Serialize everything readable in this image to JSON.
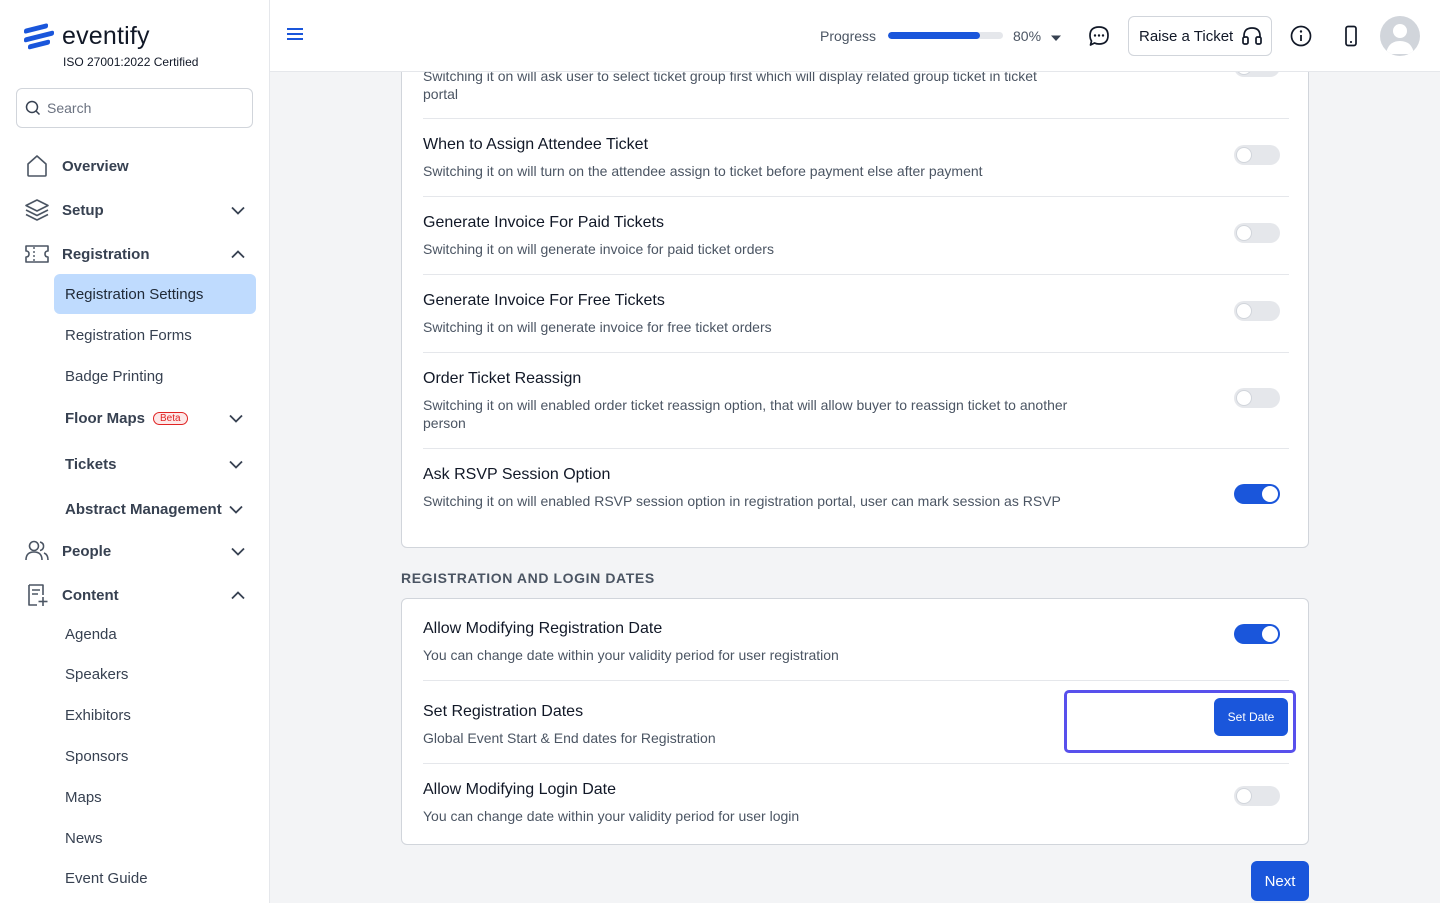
{
  "brand": {
    "name": "eventify",
    "certification": "ISO 27001:2022 Certified",
    "accent": "#1a56db"
  },
  "search": {
    "placeholder": "Search"
  },
  "sidebar": {
    "overview": "Overview",
    "setup": "Setup",
    "registration": "Registration",
    "registration_items": {
      "settings": "Registration Settings",
      "forms": "Registration Forms",
      "badge": "Badge Printing",
      "floor_maps": "Floor Maps",
      "floor_maps_badge": "Beta",
      "tickets": "Tickets",
      "abstract": "Abstract Management"
    },
    "people": "People",
    "content": "Content",
    "content_items": {
      "agenda": "Agenda",
      "speakers": "Speakers",
      "exhibitors": "Exhibitors",
      "sponsors": "Sponsors",
      "maps": "Maps",
      "news": "News",
      "event_guide": "Event Guide"
    }
  },
  "header": {
    "progress_label": "Progress",
    "progress_value": 0.8,
    "progress_text": "80%",
    "raise_ticket": "Raise a Ticket"
  },
  "settings": {
    "partial_desc": "Switching it on will ask user to select ticket group first which will display related group ticket in ticket portal",
    "items": [
      {
        "title": "When to Assign Attendee Ticket",
        "desc": "Switching it on will turn on the attendee assign to ticket before payment else after payment",
        "on": false
      },
      {
        "title": "Generate Invoice For Paid Tickets",
        "desc": "Switching it on will generate invoice for paid ticket orders",
        "on": false
      },
      {
        "title": "Generate Invoice For Free Tickets",
        "desc": "Switching it on will generate invoice for free ticket orders",
        "on": false
      },
      {
        "title": "Order Ticket Reassign",
        "desc": "Switching it on will enabled order ticket reassign option, that will allow buyer to reassign ticket to another person",
        "on": false
      },
      {
        "title": "Ask RSVP Session Option",
        "desc": "Switching it on will enabled RSVP session option in registration portal, user can mark session as RSVP",
        "on": true
      }
    ]
  },
  "dates_section": {
    "title": "REGISTRATION AND LOGIN DATES",
    "items": [
      {
        "title": "Allow Modifying Registration Date",
        "desc": "You can change date within your validity period for user registration",
        "on": true
      },
      {
        "title": "Set Registration Dates",
        "desc": "Global Event Start & End dates for Registration",
        "button": "Set Date"
      },
      {
        "title": "Allow Modifying Login Date",
        "desc": "You can change date within your validity period for user login",
        "on": false
      }
    ]
  },
  "footer": {
    "next": "Next"
  }
}
